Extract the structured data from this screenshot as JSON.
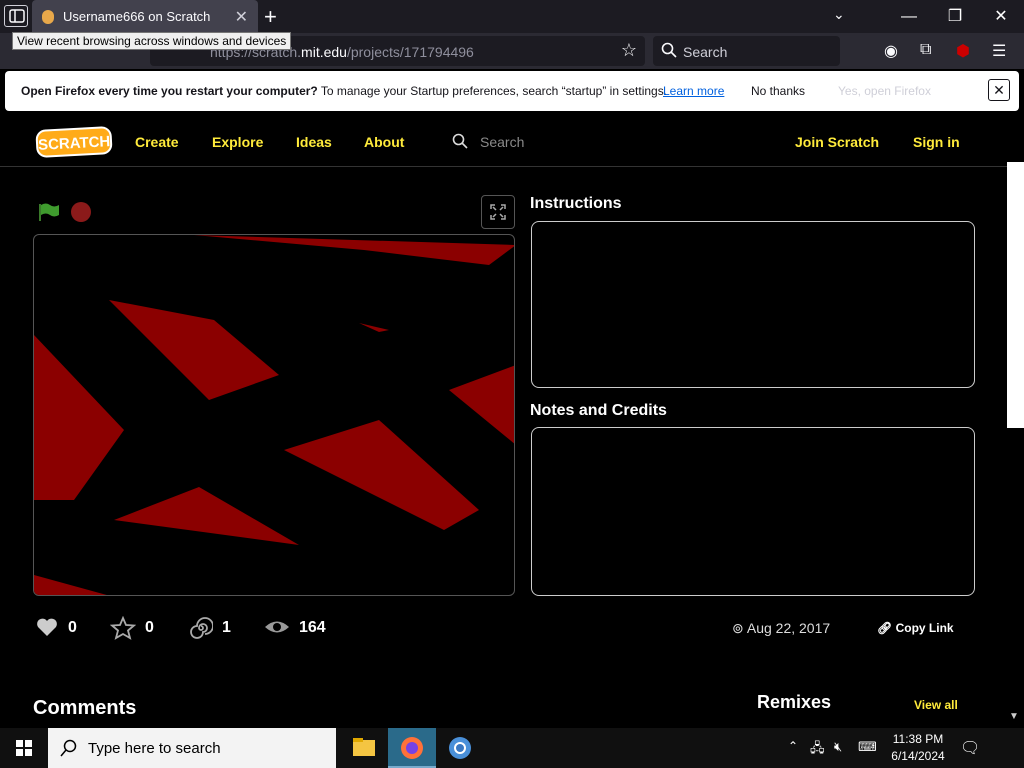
{
  "browser": {
    "tab_title": "Username666 on Scratch",
    "tooltip": "View recent browsing across windows and devices",
    "url_prefix": "https://scratch.",
    "url_domain": "mit.edu",
    "url_path": "/projects/171794496",
    "search_placeholder": "Search",
    "notification": {
      "bold": "Open Firefox every time you restart your computer?",
      "text": " To manage your Startup preferences, search “startup” in settings.",
      "learn_more": "Learn more",
      "no_thanks": "No thanks",
      "yes": "Yes, open Firefox"
    }
  },
  "scratch": {
    "logo": "SCRATCH",
    "nav": [
      "Create",
      "Explore",
      "Ideas",
      "About"
    ],
    "search_placeholder": "Search",
    "join": "Join Scratch",
    "signin": "Sign in"
  },
  "project": {
    "instructions_title": "Instructions",
    "notes_title": "Notes and Credits",
    "loves": "0",
    "favorites": "0",
    "remixes_count": "1",
    "views": "164",
    "date": "Aug 22, 2017",
    "copy_link": "Copy Link",
    "comments_title": "Comments",
    "remixes_title": "Remixes",
    "view_all": "View all"
  },
  "taskbar": {
    "search_placeholder": "Type here to search",
    "time": "11:38 PM",
    "date": "6/14/2024"
  }
}
